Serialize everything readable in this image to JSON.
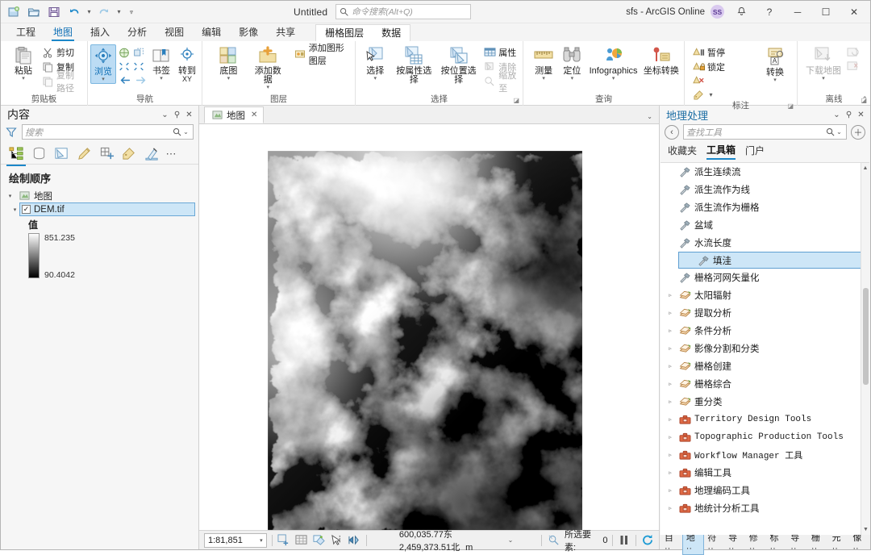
{
  "titlebar": {
    "project_title": "Untitled",
    "search_placeholder": "命令搜索(Alt+Q)",
    "account": "sfs - ArcGIS Online",
    "badge": "SS",
    "quick_access": [
      "new-project",
      "open-project",
      "save-project",
      "undo",
      "redo",
      "customize"
    ],
    "window_buttons": {
      "minimize": "─",
      "maximize": "☐",
      "close": "✕"
    },
    "help": "?"
  },
  "tabs": {
    "main": [
      "工程",
      "地图",
      "插入",
      "分析",
      "视图",
      "编辑",
      "影像",
      "共享"
    ],
    "active": "地图",
    "contextual": [
      "栅格图层",
      "数据"
    ]
  },
  "ribbon": {
    "groups": [
      {
        "title": "剪贴板",
        "big": [
          {
            "label": "粘贴",
            "dropdown": true
          }
        ],
        "small": [
          {
            "label": "剪切",
            "disabled": false
          },
          {
            "label": "复制",
            "disabled": false
          },
          {
            "label": "复制路径",
            "disabled": true
          }
        ]
      },
      {
        "title": "导航",
        "big": [
          {
            "label": "浏览",
            "selected": true,
            "dropdown": true
          },
          {
            "label": "书签",
            "dropdown": true
          },
          {
            "label": "转到",
            "label2": "XY"
          }
        ]
      },
      {
        "title": "图层",
        "big": [
          {
            "label": "底图",
            "dropdown": true
          },
          {
            "label": "添加数据",
            "dropdown": true
          }
        ],
        "small": [
          {
            "label": "添加图形图层"
          }
        ]
      },
      {
        "title": "选择",
        "dialog_launcher": true,
        "big": [
          {
            "label": "选择",
            "dropdown": true
          },
          {
            "label": "按属性选择"
          },
          {
            "label": "按位置选择"
          }
        ],
        "small": [
          {
            "label": "属性",
            "disabled": false
          },
          {
            "label": "清除",
            "disabled": true
          },
          {
            "label": "缩放至",
            "disabled": true
          }
        ]
      },
      {
        "title": "查询",
        "big": [
          {
            "label": "测量",
            "dropdown": true
          },
          {
            "label": "定位",
            "dropdown": true
          },
          {
            "label": "Infographics",
            "dropdown": true
          },
          {
            "label": "坐标转换"
          }
        ]
      },
      {
        "title": "标注",
        "dialog_launcher": true,
        "small": [
          {
            "label": "暂停"
          },
          {
            "label": "锁定"
          },
          {
            "label": ""
          },
          {
            "label": ""
          }
        ],
        "big": [
          {
            "label": "转换",
            "dropdown": true
          }
        ]
      },
      {
        "title": "离线",
        "dialog_launcher": true,
        "big": [
          {
            "label": "下载地图",
            "dropdown": true,
            "disabled": true
          }
        ]
      }
    ]
  },
  "contents_panel": {
    "title": "内容",
    "search_placeholder": "搜索",
    "toolbar_icons": [
      "drawing-order",
      "data-source",
      "selection",
      "editing",
      "snapping",
      "labeling",
      "symbology",
      "more"
    ],
    "section_title": "绘制顺序",
    "map_node": "地图",
    "layer": {
      "name": "DEM.tif",
      "checked": true,
      "selected": true
    },
    "legend": {
      "title": "值",
      "max": "851.235",
      "min": "90.4042"
    }
  },
  "map_view": {
    "tab_label": "地图",
    "tab_close": "✕",
    "scale": "1:81,851",
    "coordinates": "600,035.77东  2,459,373.51北",
    "coord_unit": "m",
    "selected_features_label": "所选要素:",
    "selected_features_count": "0"
  },
  "geoprocessing_panel": {
    "title": "地理处理",
    "search_placeholder": "查找工具",
    "tabs": [
      "收藏夹",
      "工具箱",
      "门户"
    ],
    "active_tab": "工具箱",
    "tools": [
      {
        "label": "派生连续流",
        "type": "tool",
        "level": 2
      },
      {
        "label": "派生流作为线",
        "type": "tool",
        "level": 2
      },
      {
        "label": "派生流作为栅格",
        "type": "tool",
        "level": 2
      },
      {
        "label": "盆域",
        "type": "tool",
        "level": 2
      },
      {
        "label": "水流长度",
        "type": "tool",
        "level": 2
      },
      {
        "label": "填洼",
        "type": "tool",
        "level": 2,
        "selected": true
      },
      {
        "label": "栅格河网矢量化",
        "type": "tool",
        "level": 2
      },
      {
        "label": "太阳辐射",
        "type": "toolset",
        "level": 1
      },
      {
        "label": "提取分析",
        "type": "toolset",
        "level": 1
      },
      {
        "label": "条件分析",
        "type": "toolset",
        "level": 1
      },
      {
        "label": "影像分割和分类",
        "type": "toolset",
        "level": 1
      },
      {
        "label": "栅格创建",
        "type": "toolset",
        "level": 1
      },
      {
        "label": "栅格综合",
        "type": "toolset",
        "level": 1
      },
      {
        "label": "重分类",
        "type": "toolset",
        "level": 1
      },
      {
        "label": "Territory Design Tools",
        "type": "toolbox",
        "level": 0
      },
      {
        "label": "Topographic Production Tools",
        "type": "toolbox",
        "level": 0
      },
      {
        "label": "Workflow Manager 工具",
        "type": "toolbox",
        "level": 0
      },
      {
        "label": "编辑工具",
        "type": "toolbox",
        "level": 0
      },
      {
        "label": "地理编码工具",
        "type": "toolbox",
        "level": 0
      },
      {
        "label": "地统计分析工具",
        "type": "toolbox",
        "level": 0
      }
    ]
  },
  "bottom_tabs": {
    "items": [
      "目",
      "地",
      "符",
      "导",
      "修",
      "标",
      "导",
      "栅",
      "元",
      "像"
    ],
    "active_index": 1,
    "suffix": "··"
  },
  "colors": {
    "accent": "#1b87c9",
    "panel_title": "#1c6ea4",
    "selection": "#cde6f7",
    "ribbon_bg": "#ffffff",
    "chrome_bg": "#f4f4f4"
  }
}
